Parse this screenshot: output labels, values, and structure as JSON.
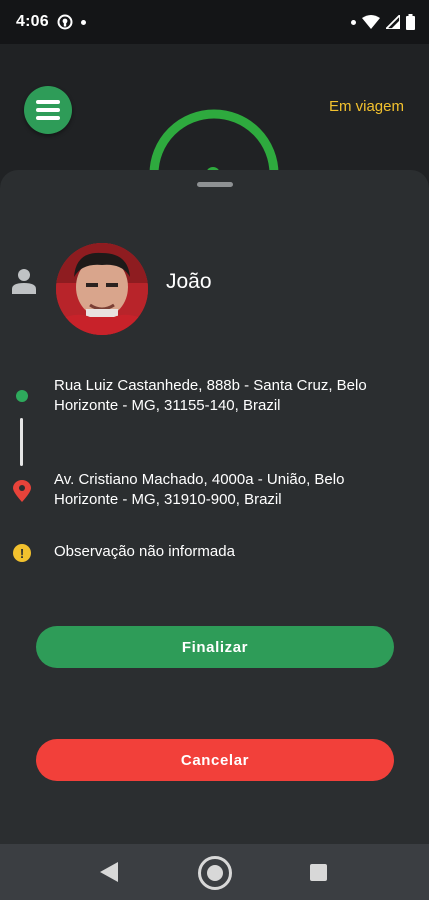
{
  "status_bar": {
    "time": "4:06",
    "icons": [
      "notification-icon",
      "dot-icon",
      "dot-icon",
      "wifi-icon",
      "signal-icon",
      "battery-icon"
    ]
  },
  "header": {
    "trip_status": "Em viagem",
    "menu_icon": "hamburger-menu-icon"
  },
  "passenger": {
    "name": "João",
    "icon": "person-icon"
  },
  "route": {
    "origin": "Rua Luiz Castanhede, 888b - Santa Cruz, Belo Horizonte - MG, 31155-140, Brazil",
    "destination": "Av. Cristiano Machado, 4000a - União, Belo Horizonte - MG, 31910-900, Brazil"
  },
  "observation": {
    "text": "Observação não informada",
    "icon": "warning-icon"
  },
  "actions": {
    "finish_label": "Finalizar",
    "cancel_label": "Cancelar"
  },
  "colors": {
    "accent_green": "#2e9c58",
    "danger_red": "#f2403a",
    "status_yellow": "#f2c12e",
    "sheet_bg": "#2b2e30"
  }
}
